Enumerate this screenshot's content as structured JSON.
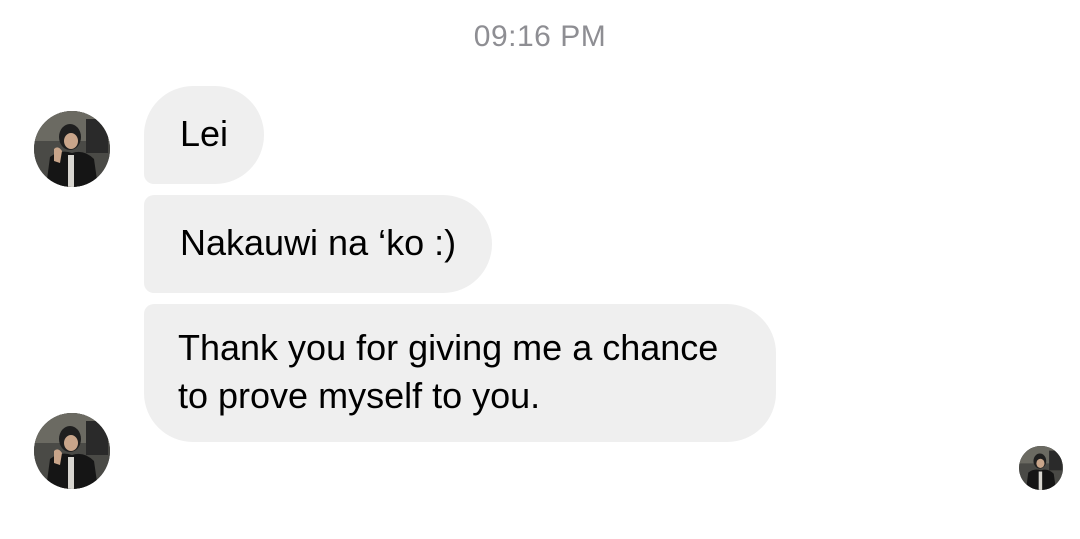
{
  "conversation": {
    "timestamp": "09:16 PM",
    "messages": [
      {
        "sender": "other",
        "text": "Lei"
      },
      {
        "sender": "other",
        "text": "Nakauwi na ‘ko :)"
      },
      {
        "sender": "other",
        "text": "Thank you for giving me a chance to prove myself to you."
      }
    ]
  },
  "colors": {
    "bubble_background": "#efefef",
    "timestamp_text": "#8e8e93",
    "message_text": "#000000",
    "page_background": "#ffffff"
  },
  "icons": {
    "avatar": "profile-photo",
    "read_receipt": "seen-avatar"
  }
}
